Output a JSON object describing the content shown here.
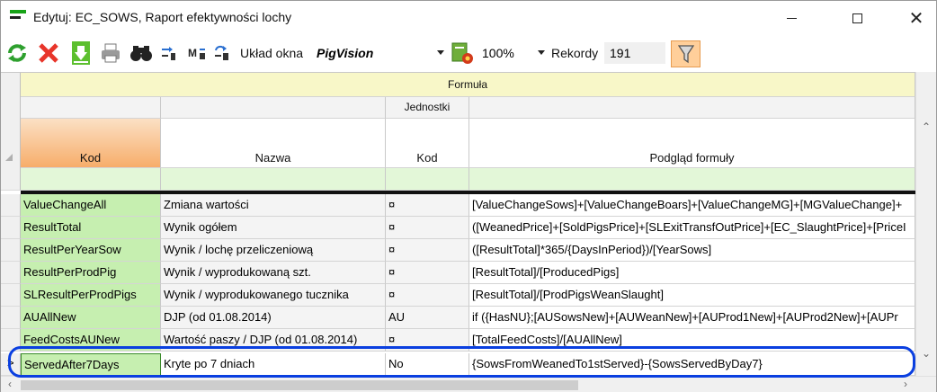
{
  "window": {
    "title": "Edytuj: EC_SOWS, Raport efektywności lochy"
  },
  "toolbar": {
    "refresh_icon": "refresh-icon",
    "delete_icon": "delete-icon",
    "save_icon": "save-icon",
    "print_icon": "print-icon",
    "search_icon": "binoculars-icon",
    "layout_label": "Układ okna",
    "layout_value": "PigVision",
    "zoom_value": "100%",
    "records_label": "Rekordy",
    "records_value": "191",
    "filter_icon": "filter-icon"
  },
  "grid": {
    "band_formula": "Formuła",
    "band_units": "Jednostki",
    "columns": {
      "kod": "Kod",
      "nazwa": "Nazwa",
      "jednostki_kod": "Kod",
      "podglad": "Podgląd formuły"
    },
    "rows": [
      {
        "kod": "ValueChangeAll",
        "nazwa": "Zmiana wartości",
        "jkod": "¤",
        "formula": "[ValueChangeSows]+[ValueChangeBoars]+[ValueChangeMG]+[MGValueChange]+"
      },
      {
        "kod": "ResultTotal",
        "nazwa": "Wynik ogółem",
        "jkod": "¤",
        "formula": "([WeanedPrice]+[SoldPigsPrice]+[SLExitTransfOutPrice]+[EC_SlaughtPrice]+[PriceI"
      },
      {
        "kod": "ResultPerYearSow",
        "nazwa": "Wynik / lochę przeliczeniową",
        "jkod": "¤",
        "formula": "([ResultTotal]*365/{DaysInPeriod})/[YearSows]"
      },
      {
        "kod": "ResultPerProdPig",
        "nazwa": "Wynik / wyprodukowaną szt.",
        "jkod": "¤",
        "formula": "[ResultTotal]/[ProducedPigs]"
      },
      {
        "kod": "SLResultPerProdPigs",
        "nazwa": "Wynik / wyprodukowanego tucznika",
        "jkod": "¤",
        "formula": "[ResultTotal]/[ProdPigsWeanSlaught]"
      },
      {
        "kod": "AUAllNew",
        "nazwa": "DJP (od 01.08.2014)",
        "jkod": "AU",
        "formula": "if ({HasNU};[AUSowsNew]+[AUWeanNew]+[AUProd1New]+[AUProd2New]+[AUPr"
      },
      {
        "kod": "FeedCostsAUNew",
        "nazwa": "Wartość paszy / DJP (od 01.08.2014)",
        "jkod": "¤",
        "formula": "[TotalFeedCosts]/[AUAllNew]"
      },
      {
        "kod": "ServedAfter7Days",
        "nazwa": "Kryte po 7 dniach",
        "jkod": "No",
        "formula": "{SowsFromWeanedTo1stServed}-{SowsServedByDay7}"
      }
    ]
  },
  "colors": {
    "kod_column": "#c6efb0",
    "header_yellow": "#f8f7c8",
    "header_orange": "#f7ad6a",
    "highlight": "#0a3fe0"
  }
}
